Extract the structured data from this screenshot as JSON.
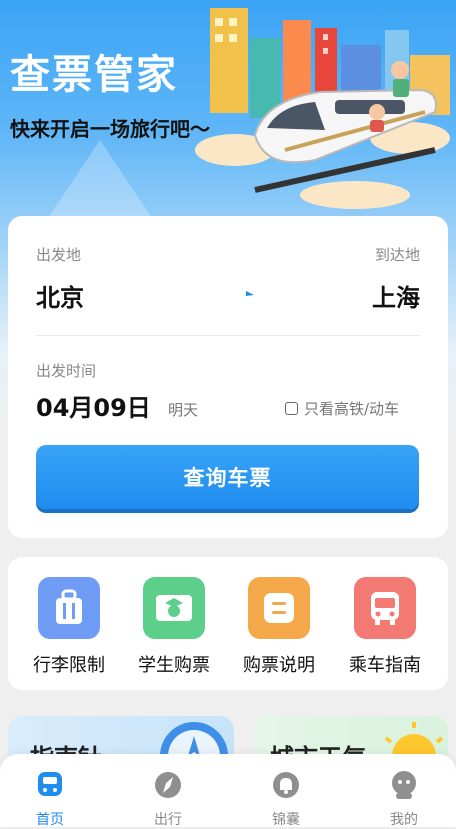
{
  "header": {
    "title": "查票管家",
    "subtitle": "快来开启一场旅行吧～"
  },
  "search": {
    "from_label": "出发地",
    "from_city": "北京",
    "to_label": "到达地",
    "to_city": "上海",
    "date_label": "出发时间",
    "date_value": "04月09日",
    "day_hint": "明天",
    "filter_label": "只看高铁/动车",
    "filter_checked": false,
    "query_button": "查询车票",
    "accent_color": "#1f8cf0"
  },
  "quick_actions": [
    {
      "label": "行李限制",
      "icon": "luggage-icon",
      "color": "#6f9cf4"
    },
    {
      "label": "学生购票",
      "icon": "student-ticket-icon",
      "color": "#5ccf8a"
    },
    {
      "label": "购票说明",
      "icon": "ticket-info-icon",
      "color": "#f5a84a"
    },
    {
      "label": "乘车指南",
      "icon": "bus-icon",
      "color": "#f27a72"
    }
  ],
  "promos": [
    {
      "label": "指南针",
      "icon": "compass-icon"
    },
    {
      "label": "城市天气",
      "icon": "sun-icon"
    }
  ],
  "tabbar": [
    {
      "label": "首页",
      "icon": "home-train-icon",
      "active": true
    },
    {
      "label": "出行",
      "icon": "compass-icon",
      "active": false
    },
    {
      "label": "锦囊",
      "icon": "bell-icon",
      "active": false
    },
    {
      "label": "我的",
      "icon": "profile-icon",
      "active": false
    }
  ]
}
